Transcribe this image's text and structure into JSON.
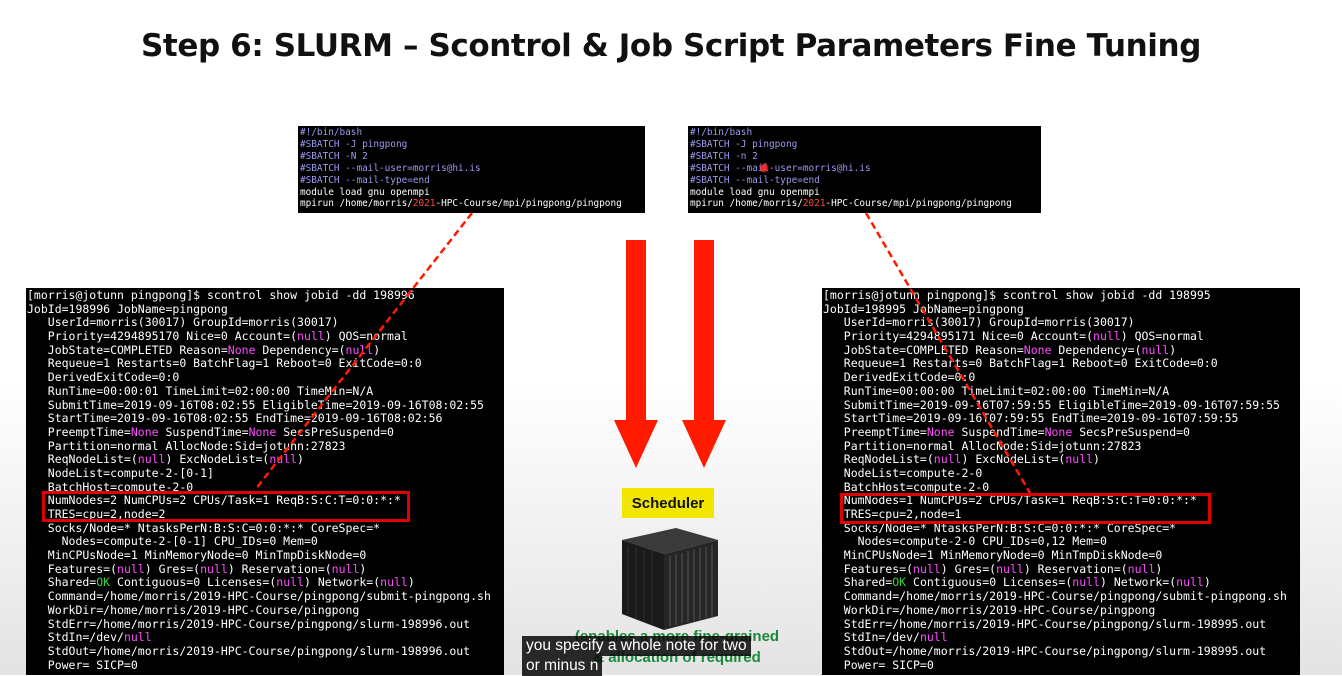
{
  "slide": {
    "title": "Step 6:  SLURM – Scontrol & Job Script Parameters Fine Tuning"
  },
  "scheduler": {
    "label": "Scheduler",
    "note_line1": "(enables a more fine-grained",
    "note_line2": "& allocation of required"
  },
  "caption": {
    "line1": "you specify a whole note for two",
    "line2": "or minus n"
  },
  "colors": {
    "highlight_box": "#e10000",
    "arrow": "#ff1a00",
    "scheduler_badge": "#f2e600",
    "note_text": "#1a8a3a"
  },
  "script_left": {
    "shebang": "#!/bin/bash",
    "job_name": "#SBATCH -J pingpong",
    "nodes": "#SBATCH -N 2",
    "mail_user": "#SBATCH --mail-user=morris@hi.is",
    "mail_type": "#SBATCH --mail-type=end",
    "module": "module load gnu openmpi",
    "mpirun_prefix": "mpirun /home/morris/",
    "mpirun_year": "2021",
    "mpirun_suffix": "-HPC-Course/mpi/pingpong/pingpong"
  },
  "script_right": {
    "shebang": "#!/bin/bash",
    "job_name": "#SBATCH -J pingpong",
    "nodes": "#SBATCH -n 2",
    "mail_user": "#SBATCH --mail-user=morris@hi.is",
    "mail_type": "#SBATCH --mail-type=end",
    "module": "module load gnu openmpi",
    "mpirun_prefix": "mpirun /home/morris/",
    "mpirun_year": "2021",
    "mpirun_suffix": "-HPC-Course/mpi/pingpong/pingpong"
  },
  "scontrol_left": {
    "prompt": "[morris@jotunn pingpong]$ scontrol show jobid -dd 198996",
    "jobid": "JobId=198996 JobName=pingpong",
    "userid": "   UserId=morris(30017) GroupId=morris(30017)",
    "priority_a": "   Priority=4294895170 Nice=0 Account=(",
    "priority_b": ") QOS=normal",
    "jobstate_a": "   JobState=COMPLETED Reason=",
    "jobstate_b": " Dependency=(",
    "jobstate_c": ")",
    "requeue": "   Requeue=1 Restarts=0 BatchFlag=1 Reboot=0 ExitCode=0:0",
    "derived": "   DerivedExitCode=0:0",
    "runtime": "   RunTime=00:00:01 TimeLimit=02:00:00 TimeMin=N/A",
    "submit": "   SubmitTime=2019-09-16T08:02:55 EligibleTime=2019-09-16T08:02:55",
    "start": "   StartTime=2019-09-16T08:02:55 EndTime=2019-09-16T08:02:56",
    "preempt_a": "   PreemptTime=",
    "preempt_b": " SuspendTime=",
    "preempt_c": " SecsPreSuspend=0",
    "partition": "   Partition=normal AllocNode:Sid=jotunn:27823",
    "reqnode_a": "   ReqNodeList=(",
    "reqnode_b": ") ExcNodeList=(",
    "reqnode_c": ")",
    "nodelist": "   NodeList=compute-2-[0-1]",
    "batchhost": "   BatchHost=compute-2-0",
    "numnodes": "   NumNodes=2 NumCPUs=2 CPUs/Task=1 ReqB:S:C:T=0:0:*:*",
    "tres": "   TRES=cpu=2,node=2",
    "socks": "   Socks/Node=* NtasksPerN:B:S:C=0:0:*:* CoreSpec=*",
    "nodes": "     Nodes=compute-2-[0-1] CPU_IDs=0 Mem=0",
    "mincpus": "   MinCPUsNode=1 MinMemoryNode=0 MinTmpDiskNode=0",
    "features_a": "   Features=(",
    "features_b": ") Gres=(",
    "features_c": ") Reservation=(",
    "features_d": ")",
    "shared_a": "   Shared=",
    "shared_ok": "OK",
    "shared_b": " Contiguous=0 Licenses=(",
    "shared_c": ") Network=(",
    "shared_d": ")",
    "command": "   Command=/home/morris/2019-HPC-Course/pingpong/submit-pingpong.sh",
    "workdir": "   WorkDir=/home/morris/2019-HPC-Course/pingpong",
    "stderr": "   StdErr=/home/morris/2019-HPC-Course/pingpong/slurm-198996.out",
    "stdin_a": "   StdIn=/dev/",
    "stdout": "   StdOut=/home/morris/2019-HPC-Course/pingpong/slurm-198996.out",
    "power": "   Power= SICP=0"
  },
  "scontrol_right": {
    "prompt": "[morris@jotunn pingpong]$ scontrol show jobid -dd 198995",
    "jobid": "JobId=198995 JobName=pingpong",
    "userid": "   UserId=morris(30017) GroupId=morris(30017)",
    "priority_a": "   Priority=4294895171 Nice=0 Account=(",
    "priority_b": ") QOS=normal",
    "jobstate_a": "   JobState=COMPLETED Reason=",
    "jobstate_b": " Dependency=(",
    "jobstate_c": ")",
    "requeue": "   Requeue=1 Restarts=0 BatchFlag=1 Reboot=0 ExitCode=0:0",
    "derived": "   DerivedExitCode=0:0",
    "runtime": "   RunTime=00:00:00 TimeLimit=02:00:00 TimeMin=N/A",
    "submit": "   SubmitTime=2019-09-16T07:59:55 EligibleTime=2019-09-16T07:59:55",
    "start": "   StartTime=2019-09-16T07:59:55 EndTime=2019-09-16T07:59:55",
    "preempt_a": "   PreemptTime=",
    "preempt_b": " SuspendTime=",
    "preempt_c": " SecsPreSuspend=0",
    "partition": "   Partition=normal AllocNode:Sid=jotunn:27823",
    "reqnode_a": "   ReqNodeList=(",
    "reqnode_b": ") ExcNodeList=(",
    "reqnode_c": ")",
    "nodelist": "   NodeList=compute-2-0",
    "batchhost": "   BatchHost=compute-2-0",
    "numnodes": "   NumNodes=1 NumCPUs=2 CPUs/Task=1 ReqB:S:C:T=0:0:*:*",
    "tres": "   TRES=cpu=2,node=1",
    "socks": "   Socks/Node=* NtasksPerN:B:S:C=0:0:*:* CoreSpec=*",
    "nodes": "     Nodes=compute-2-0 CPU_IDs=0,12 Mem=0",
    "mincpus": "   MinCPUsNode=1 MinMemoryNode=0 MinTmpDiskNode=0",
    "features_a": "   Features=(",
    "features_b": ") Gres=(",
    "features_c": ") Reservation=(",
    "features_d": ")",
    "shared_a": "   Shared=",
    "shared_ok": "OK",
    "shared_b": " Contiguous=0 Licenses=(",
    "shared_c": ") Network=(",
    "shared_d": ")",
    "command": "   Command=/home/morris/2019-HPC-Course/pingpong/submit-pingpong.sh",
    "workdir": "   WorkDir=/home/morris/2019-HPC-Course/pingpong",
    "stderr": "   StdErr=/home/morris/2019-HPC-Course/pingpong/slurm-198995.out",
    "stdin_a": "   StdIn=/dev/",
    "stdout": "   StdOut=/home/morris/2019-HPC-Course/pingpong/slurm-198995.out",
    "power": "   Power= SICP=0"
  },
  "tokens": {
    "null": "null",
    "none": "None"
  }
}
